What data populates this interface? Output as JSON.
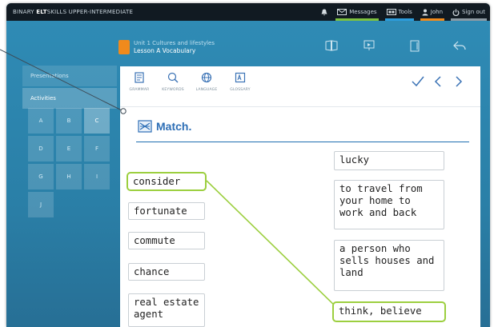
{
  "app": {
    "title_prefix": "BINARY ",
    "title_brand": "ELT",
    "title_rest": "SKILLS UPPER-INTERMEDIATE"
  },
  "topnav": {
    "messages": "Messages",
    "tools": "Tools",
    "user": "John",
    "signout": "Sign out",
    "colors": {
      "bell": "#9aa6ae",
      "messages": "#7dc13f",
      "tools": "#2d9cdb",
      "user": "#f08a1c",
      "signout": "#8e9aa3"
    }
  },
  "unit": {
    "line1": "Unit 1 Cultures and lifestyles",
    "line2": "Lesson A Vocabulary"
  },
  "sidebar": {
    "tabs": [
      "Presentations",
      "Activities"
    ],
    "grid": [
      "A",
      "B",
      "C",
      "D",
      "E",
      "F",
      "G",
      "H",
      "I",
      "J"
    ],
    "active_index": 2
  },
  "toolbar": {
    "tools": [
      "GRAMMAR",
      "KEYWORDS",
      "LANGUAGE",
      "GLOSSARY"
    ]
  },
  "exercise": {
    "title": "Match.",
    "left_words": [
      "consider",
      "fortunate",
      "commute",
      "chance",
      "real estate\nagent"
    ],
    "right_words": [
      "lucky",
      "to travel from\nyour home to\nwork and back",
      "a person who\nsells houses and\nland",
      "think, believe"
    ],
    "highlighted_pair": [
      "consider",
      "think, believe"
    ],
    "colors": {
      "accent": "#9ccf3f",
      "title": "#2e6fb6"
    }
  }
}
